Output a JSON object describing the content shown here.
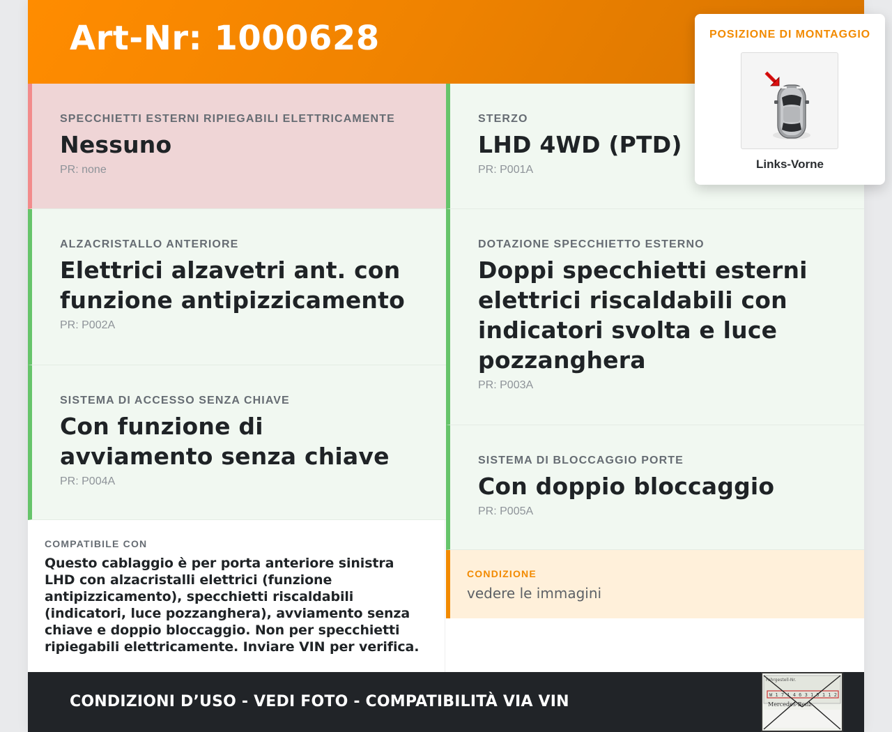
{
  "header": {
    "title": "Art-Nr: 1000628"
  },
  "specs": {
    "folding_mirrors": {
      "label": "SPECCHIETTI ESTERNI RIPIEGABILI ELETTRICAMENTE",
      "value": "Nessuno",
      "pr": "PR: none"
    },
    "steering": {
      "label": "STERZO",
      "value": "LHD 4WD (PTD)",
      "pr": "PR: P001A"
    },
    "front_window": {
      "label": "ALZACRISTALLO ANTERIORE",
      "value": "Elettrici alzavetri ant. con funzione antipizzicamento",
      "pr": "PR: P002A"
    },
    "mirror_equipment": {
      "label": "DOTAZIONE SPECCHIETTO ESTERNO",
      "value": "Doppi specchietti esterni elettrici riscaldabili con indicatori svolta e luce pozzanghera",
      "pr": "PR: P003A"
    },
    "keyless": {
      "label": "SISTEMA DI ACCESSO SENZA CHIAVE",
      "value": "Con funzione di avviamento senza chiave",
      "pr": "PR: P004A"
    },
    "door_lock": {
      "label": "SISTEMA DI BLOCCAGGIO PORTE",
      "value": "Con doppio bloccaggio",
      "pr": "PR: P005A"
    }
  },
  "compatibility": {
    "label": "COMPATIBILE CON",
    "text": "Questo cablaggio è per porta anteriore sinistra LHD con alzacristalli elettrici (funzione antipizzicamento), specchietti riscaldabili (indicatori, luce pozzanghera), avviamento senza chiave e doppio bloccaggio. Non per specchietti ripiegabili elettricamente. Inviare VIN per verifica."
  },
  "condition": {
    "label": "CONDIZIONE",
    "value": "vedere le immagini"
  },
  "footer": {
    "text": "CONDIZIONI D’USO - VEDI FOTO - COMPATIBILITÀ VIA VIN",
    "thumb_label": "Fahrgestell-Nr.",
    "thumb_vin": "W 1 7 1 4 6 3 1 5 1 1 2",
    "thumb_brand": "Mercedes-Benz"
  },
  "mounting": {
    "title": "POSIZIONE DI MONTAGGIO",
    "caption": "Links-Vorne"
  },
  "colors": {
    "accent_orange": "#ff8c00",
    "green_border": "#66c46a",
    "red_border": "#f28b8b",
    "footer_bg": "#212428"
  }
}
